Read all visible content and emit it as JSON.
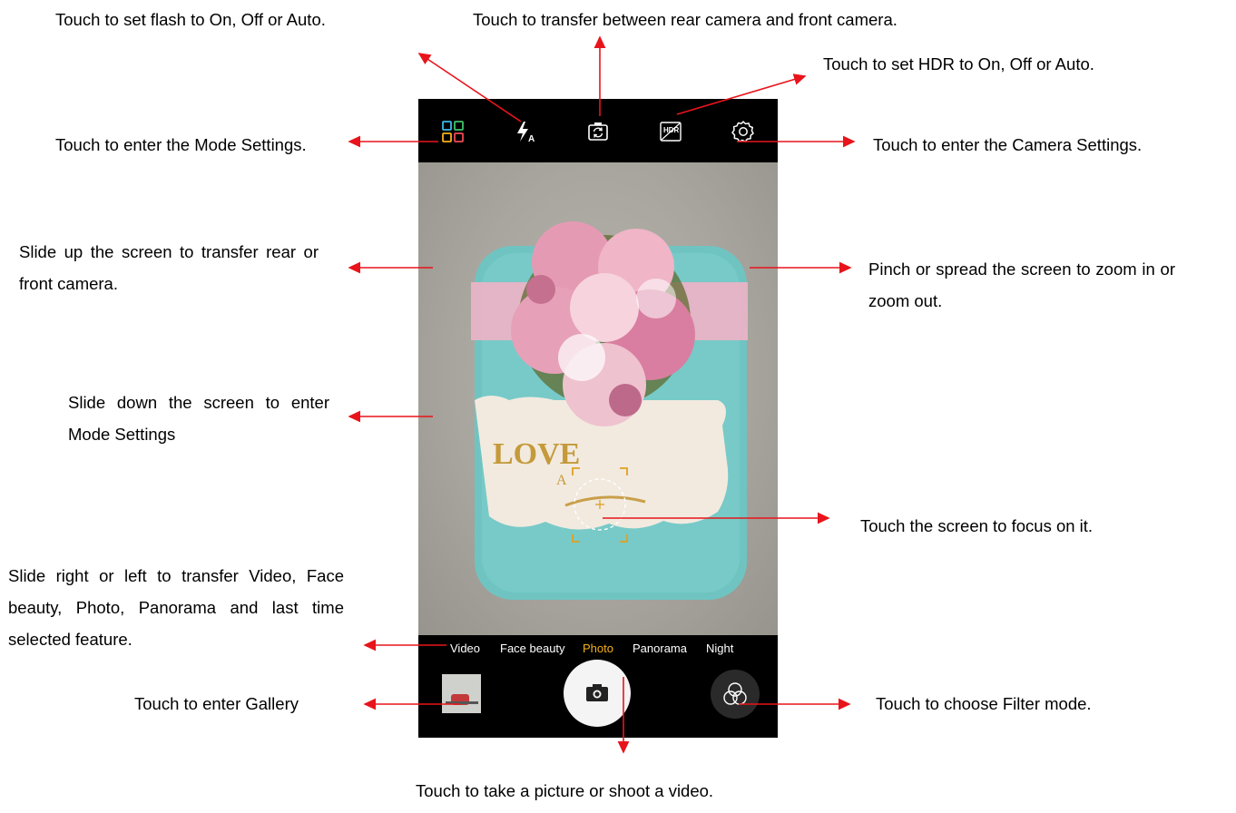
{
  "captions": {
    "flash": "Touch to set flash to On, Off or Auto.",
    "switch_camera": "Touch to transfer between rear camera and front camera.",
    "hdr": "Touch to set HDR to On, Off or Auto.",
    "mode_settings": "Touch to enter the Mode Settings.",
    "camera_settings": "Touch to enter the Camera Settings.",
    "slide_up": "Slide up the screen to transfer rear or front camera.",
    "pinch": "Pinch or spread the screen to zoom in or zoom out.",
    "slide_down": "Slide down the screen to enter Mode Settings",
    "focus": "Touch the screen to focus on it.",
    "slide_modes": "Slide right or left to transfer Video, Face beauty, Photo, Panorama and last time selected feature.",
    "gallery": "Touch to enter Gallery",
    "filter": "Touch to choose Filter mode.",
    "shutter": "Touch to take a picture or shoot a video."
  },
  "phone": {
    "top_icons": [
      "mode-grid-icon",
      "flash-auto-icon",
      "switch-camera-icon",
      "hdr-icon",
      "gear-icon"
    ],
    "hdr_label": "HDR",
    "modes": [
      "Video",
      "Face beauty",
      "Photo",
      "Panorama",
      "Night"
    ],
    "selected_mode": "Photo",
    "photo_text": [
      "LOVE",
      "A"
    ]
  },
  "colors": {
    "arrow": "#e8141b",
    "selected_mode": "#f5b01a",
    "focus": "#e0a020",
    "box": "#6fc4c2",
    "ribbon": "#e9b3c6"
  }
}
